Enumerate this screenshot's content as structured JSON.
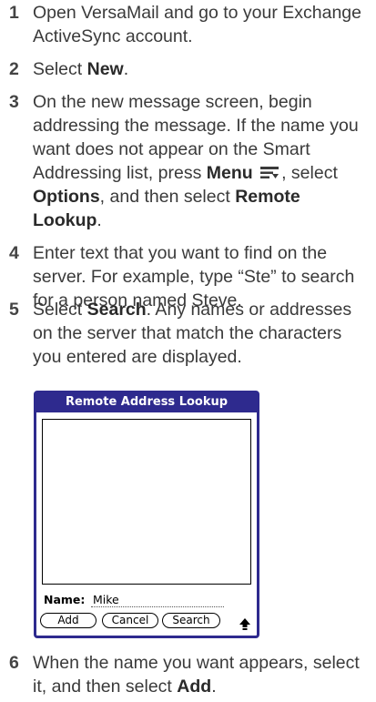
{
  "steps": [
    {
      "number": "1",
      "parts": [
        "Open VersaMail and go to your Exchange ActiveSync account."
      ]
    },
    {
      "number": "2",
      "pre": "Select ",
      "bold1": "New",
      "post": "."
    },
    {
      "number": "3",
      "line1": "On the new message screen, begin addressing the message. If the name you want does not appear on the Smart Addressing list, press ",
      "menu": "Menu",
      "after_menu": ", select ",
      "options": "Options",
      "mid": ", and then select ",
      "remote": "Remote Lookup",
      "end": "."
    },
    {
      "number": "4",
      "text": "Enter text that you want to find on the server. For example, type “Ste” to search for a person named Steve."
    },
    {
      "number": "5",
      "pre": "Select ",
      "bold1": "Search",
      "post": ". Any names or addresses on the server that match the characters you entered are displayed."
    },
    {
      "number": "6",
      "pre": "When the name you want appears, select it, and then select ",
      "bold1": "Add",
      "post": "."
    }
  ],
  "dialog": {
    "title": "Remote Address Lookup",
    "name_label": "Name:",
    "name_value": "Mike",
    "buttons": [
      "Add",
      "Cancel",
      "Search"
    ],
    "shift_icon": "shift-arrow-icon",
    "accent_color": "#2e2a8e"
  }
}
